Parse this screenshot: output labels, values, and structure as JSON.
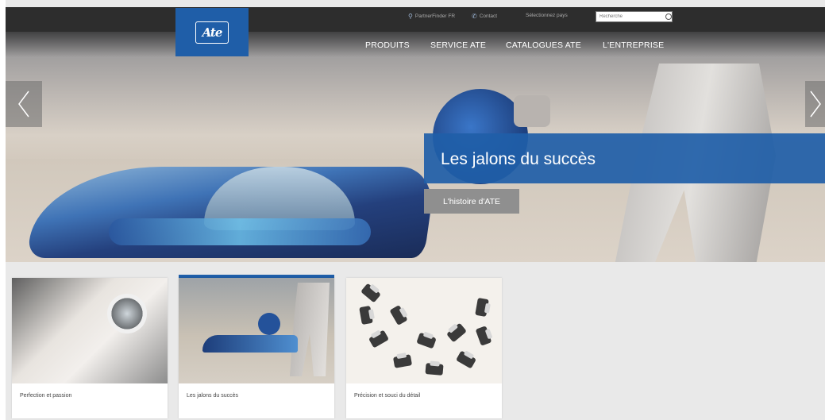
{
  "header": {
    "logo_text": "Ate",
    "utility": {
      "partner_finder": "PartnerFinder FR",
      "contact": "Contact",
      "country_select": "Sélectionnez pays",
      "search_placeholder": "Recherche"
    },
    "nav": [
      "PRODUITS",
      "SERVICE ATE",
      "CATALOGUES ATE",
      "L'ENTREPRISE"
    ]
  },
  "hero": {
    "title": "Les jalons du succès",
    "cta_label": "L'histoire d'ATE",
    "colors": {
      "accent": "#1f5ea8",
      "cta_bg": "#8f8f8f"
    }
  },
  "cards": [
    {
      "label": "Perfection et passion"
    },
    {
      "label": "Les jalons du succès",
      "active": true
    },
    {
      "label": "Précision et souci du détail"
    }
  ],
  "icons": [
    "ate-logo-icon",
    "location-pin-icon",
    "phone-icon",
    "search-icon",
    "chevron-left-icon",
    "chevron-right-icon"
  ]
}
